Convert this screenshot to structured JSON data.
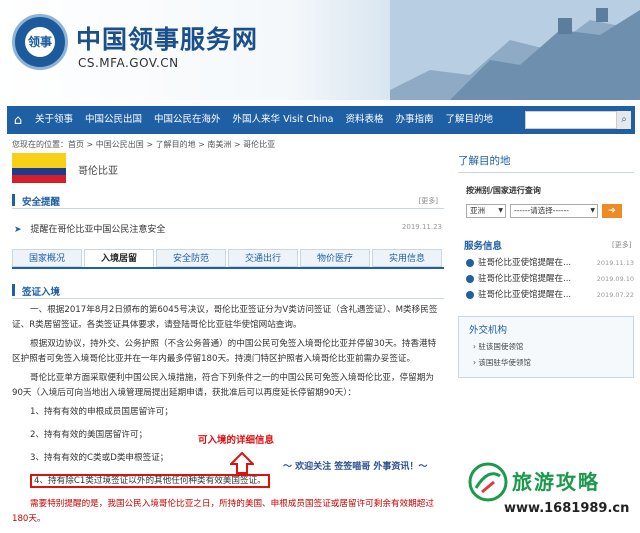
{
  "header": {
    "logo_text": "领事",
    "title": "中国领事服务网",
    "url": "CS.MFA.GOV.CN"
  },
  "nav": {
    "items": [
      "关于领事",
      "中国公民出国",
      "中国公民在海外",
      "外国人来华 Visit China",
      "资料表格",
      "办事指南",
      "了解目的地"
    ],
    "search_placeholder": ""
  },
  "breadcrumb": "您现在的位置：首页 > 中国公民出国 > 了解目的地 > 南美洲 > 哥伦比亚",
  "country": {
    "name": "哥伦比亚"
  },
  "safety": {
    "heading": "安全提醒",
    "more": "[更多]",
    "notice": "提醒在哥伦比亚中国公民注意安全",
    "date": "2019.11.23"
  },
  "tabs": [
    "国家概况",
    "入境居留",
    "安全防范",
    "交通出行",
    "物价医疗",
    "实用信息"
  ],
  "visa": {
    "heading": "签证入境",
    "para1": "一、根据2017年8月2日颁布的第6045号决议，哥伦比亚签证分为V类访问签证（含礼遇签证）、M类移民签证、R类居留签证。各类签证具体要求，请登陆哥伦比亚驻华使馆网站查询。",
    "para2": "根据双边协议，持外交、公务护照（不含公务普通）的中国公民可免签入境哥伦比亚并停留30天。持香港特区护照者可免签入境哥伦比亚并在一年内最多停留180天。持澳门特区护照者入境哥伦比亚前需办妥签证。",
    "para3": "哥伦比亚单方面采取便利中国公民入境措施，符合下列条件之一的中国公民可免签入境哥伦比亚，停留期为90天（入境后可向当地出入境管理局提出延期申请，获批准后可以再度延长停留期90天）：",
    "req1": "1、持有有效的申根成员国居留许可；",
    "req2": "2、持有有效的美国居留许可；",
    "req3": "3、持有有效的C类或D类申根签证；",
    "req4": "4、持有除C1类过境签证以外的其他任何种类有效美国签证。",
    "warning": "需要特别提醒的是，我国公民入境哥伦比亚之日，所持的美国、申根成员国签证或居留许可剩余有效期超过180天。"
  },
  "annotations": {
    "detail": "可入境的详细信息",
    "follow": "～ 欢迎关注 签签喵哥 外事资讯！～"
  },
  "sidebar": {
    "title": "了解目的地",
    "filter_label": "按洲别/国家进行查询",
    "continent": "亚洲",
    "country_select": "------请选择------",
    "services_heading": "服务信息",
    "more": "[更多]",
    "services": [
      {
        "text": "驻哥伦比亚使馆提醒在...",
        "date": "2019.11.13"
      },
      {
        "text": "驻哥伦比亚使馆提醒在...",
        "date": "2019.09.10"
      },
      {
        "text": "驻哥伦比亚使馆提醒在...",
        "date": "2019.07.22"
      }
    ],
    "diplomatic_heading": "外交机构",
    "diplomatic": [
      "驻该国使领馆",
      "该国驻华使领馆"
    ]
  },
  "watermark": {
    "title": "旅游攻略",
    "url": "www.1681989.cn"
  },
  "colors": {
    "primary": "#1f5fa3",
    "alert": "#dd1111",
    "accent": "#f08a24"
  }
}
